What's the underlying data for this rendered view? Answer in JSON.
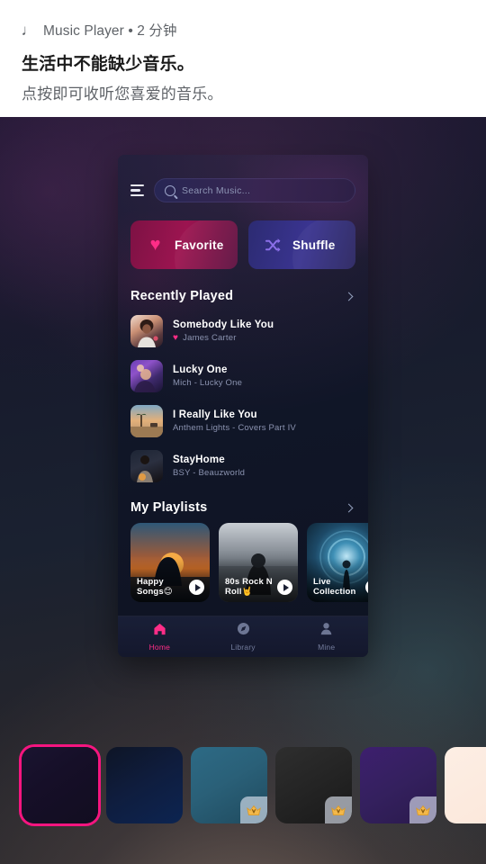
{
  "notification": {
    "app_icon": "music-note-icon",
    "app_name": "Music Player",
    "separator": "•",
    "time": "2 分钟",
    "meta_line": "Music Player • 2 分钟",
    "title": "生活中不能缺少音乐。",
    "subtitle": "点按即可收听您喜爱的音乐。"
  },
  "app": {
    "menu_icon": "hamburger-menu-icon",
    "search": {
      "icon": "search-icon",
      "placeholder": "Search Music...",
      "value": ""
    },
    "quick_actions": [
      {
        "label": "Favorite",
        "icon": "heart-icon",
        "color": "#9c1450"
      },
      {
        "label": "Shuffle",
        "icon": "shuffle-icon",
        "color": "#3a3490"
      }
    ],
    "recently_played": {
      "title": "Recently Played",
      "chevron": "chevron-right-icon",
      "tracks": [
        {
          "name": "Somebody Like You",
          "artist": "James Carter",
          "liked": true
        },
        {
          "name": "Lucky One",
          "artist": "Mich - Lucky One",
          "liked": false
        },
        {
          "name": "I Really Like You",
          "artist": "Anthem Lights - Covers Part IV",
          "liked": false
        },
        {
          "name": "StayHome",
          "artist": "BSY - Beauzworld",
          "liked": false
        }
      ]
    },
    "my_playlists": {
      "title": "My Playlists",
      "chevron": "chevron-right-icon",
      "items": [
        {
          "name": "Happy Songs😊"
        },
        {
          "name": "80s Rock N Roll🤘"
        },
        {
          "name": "Live Collection"
        }
      ]
    },
    "nav": [
      {
        "label": "Home",
        "icon": "home-icon",
        "active": true
      },
      {
        "label": "Library",
        "icon": "compass-icon",
        "active": false
      },
      {
        "label": "Mine",
        "icon": "person-icon",
        "active": false
      }
    ]
  },
  "themes": {
    "swatches": [
      {
        "name": "midnight-purple",
        "selected": true,
        "premium": false
      },
      {
        "name": "deep-blue",
        "selected": false,
        "premium": false
      },
      {
        "name": "teal",
        "selected": false,
        "premium": true
      },
      {
        "name": "charcoal",
        "selected": false,
        "premium": true
      },
      {
        "name": "violet",
        "selected": false,
        "premium": true
      },
      {
        "name": "cream",
        "selected": false,
        "premium": false
      }
    ],
    "premium_badge_icon": "crown-icon",
    "accent_color": "#f5157f"
  }
}
